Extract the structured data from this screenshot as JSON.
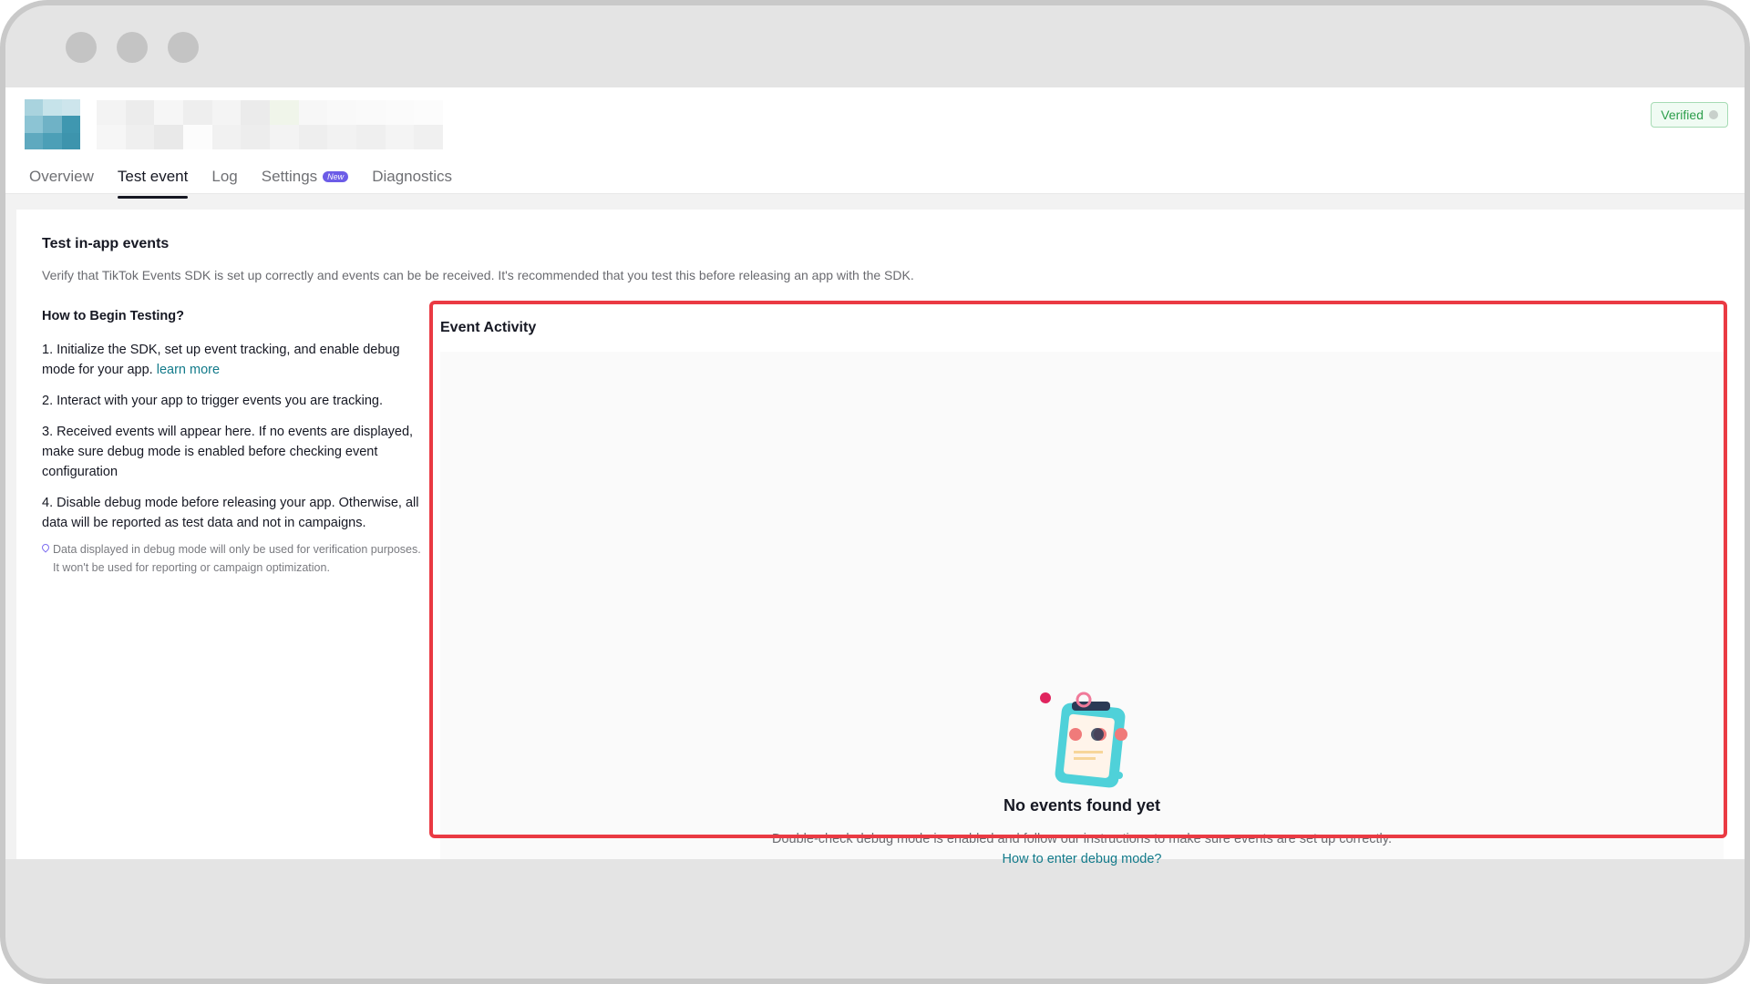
{
  "window": {
    "controls": [
      "close",
      "minimize",
      "zoom"
    ]
  },
  "header": {
    "verified_label": "Verified",
    "tabs": [
      {
        "label": "Overview",
        "active": false
      },
      {
        "label": "Test event",
        "active": true
      },
      {
        "label": "Log",
        "active": false
      },
      {
        "label": "Settings",
        "active": false,
        "badge": "New"
      },
      {
        "label": "Diagnostics",
        "active": false
      }
    ]
  },
  "main": {
    "title": "Test in-app events",
    "description": "Verify that TikTok Events SDK is set up correctly and events can be be received. It's recommended that you test this before releasing an app with the SDK.",
    "how_to": {
      "heading": "How to Begin Testing?",
      "step1": "1. Initialize the SDK, set up event tracking, and enable debug mode for your app.",
      "step1_link": "learn more",
      "step2": "2. Interact with your app to trigger events you are tracking.",
      "step3": "3. Received events will appear here. If no events are displayed, make sure debug mode is enabled before checking event configuration",
      "step4": "4. Disable debug mode before releasing your app. Otherwise, all data will be reported as test data and not in campaigns.",
      "note": "Data displayed in debug mode will only be used for verification purposes. It won't be used for reporting or campaign optimization."
    },
    "event_activity": {
      "title": "Event Activity",
      "empty_title": "No events found yet",
      "empty_description": "Double-check debug mode is enabled and follow our instructions to make sure events are set up correctly.",
      "empty_link": "How to enter debug mode?"
    }
  },
  "colors": {
    "accent_link": "#127a8a",
    "highlight_border": "#ea3a43",
    "badge": "#6c5ce7",
    "verified": "#2c9e4b"
  }
}
